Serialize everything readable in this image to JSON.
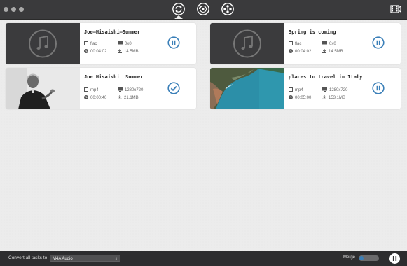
{
  "window": {
    "tabs": [
      {
        "name": "converting-tab",
        "active": true
      },
      {
        "name": "disc-tab",
        "active": false
      },
      {
        "name": "film-reel-tab",
        "active": false
      }
    ]
  },
  "tasks": [
    {
      "title": "Joe—Hisaishi—Summer",
      "format": "flac",
      "resolution": "0x0",
      "duration": "00:04:02",
      "size": "14.5MB",
      "state": "paused",
      "thumbnail": "audio"
    },
    {
      "title": "Spring is coming",
      "format": "flac",
      "resolution": "0x0",
      "duration": "00:04:02",
      "size": "14.5MB",
      "state": "paused",
      "thumbnail": "audio"
    },
    {
      "title": "Joe Hisaishi  Summer",
      "format": "mp4",
      "resolution": "1280x720",
      "duration": "00:00:40",
      "size": "21.1MB",
      "state": "completed",
      "thumbnail": "portrait"
    },
    {
      "title": "places to travel in Italy",
      "format": "mp4",
      "resolution": "1280x720",
      "duration": "00:05:00",
      "size": "153.1MB",
      "state": "paused",
      "thumbnail": "coast"
    }
  ],
  "bottom": {
    "convert_label": "Convert all tasks to",
    "format_value": "M4A Audio",
    "merge_label": "Merge",
    "merge_on": false
  },
  "colors": {
    "accent": "#3a7fb8",
    "titlebar": "#3a3a3c",
    "bottombar": "#2d2d2f"
  }
}
